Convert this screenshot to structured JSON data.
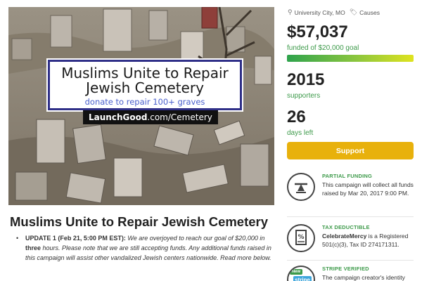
{
  "hero": {
    "title": "Muslims Unite to Repair Jewish Cemetery",
    "subtitle": "donate to repair 100+ graves",
    "url_brand": "LaunchGood",
    "url_path": ".com/Cemetery"
  },
  "campaign": {
    "title": "Muslims Unite to Repair Jewish Cemetery",
    "update_bullet": "•",
    "update_label": "UPDATE 1 (Feb 21, 5:00 PM EST):",
    "update_text_1": " We are overjoyed to reach our goal of $20,000 in ",
    "update_bold": "three",
    "update_text_2": " hours. Please note that we are still accepting funds. Any additional funds raised in this campaign will assist other vandalized Jewish centers nationwide. Read more below."
  },
  "sidebar": {
    "location": "University City, MO",
    "category": "Causes",
    "raised": "$57,037",
    "goal_text": "funded of $20,000 goal",
    "progress_fraction": 1.0,
    "supporters_count": "2015",
    "supporters_label": "supporters",
    "days_count": "26",
    "days_label": "days left",
    "support_label": "Support"
  },
  "features": [
    {
      "heading": "PARTIAL FUNDING",
      "body": "This campaign will collect all funds raised by Mar 20, 2017 9:00 PM."
    },
    {
      "heading": "TAX DEDUCTIBLE",
      "body_bold": "CelebrateMercy",
      "body": " is a Registered 501(c)(3), Tax ID 274171311."
    },
    {
      "heading": "STRIPE VERIFIED",
      "body": "The campaign creator's identity",
      "badge_new": "New",
      "badge_stripe": "stripe"
    }
  ],
  "colors": {
    "accent_green": "#3d9a4a",
    "button_gold": "#e8b10c",
    "card_border": "#2f2f88",
    "subtitle_blue": "#4a60cc"
  },
  "icons": {
    "location": "map-pin-icon",
    "category": "tag-icon",
    "partial_funding": "balance-scale-icon",
    "tax_deductible": "receipt-percent-icon",
    "stripe": "stripe-badge-icon"
  }
}
